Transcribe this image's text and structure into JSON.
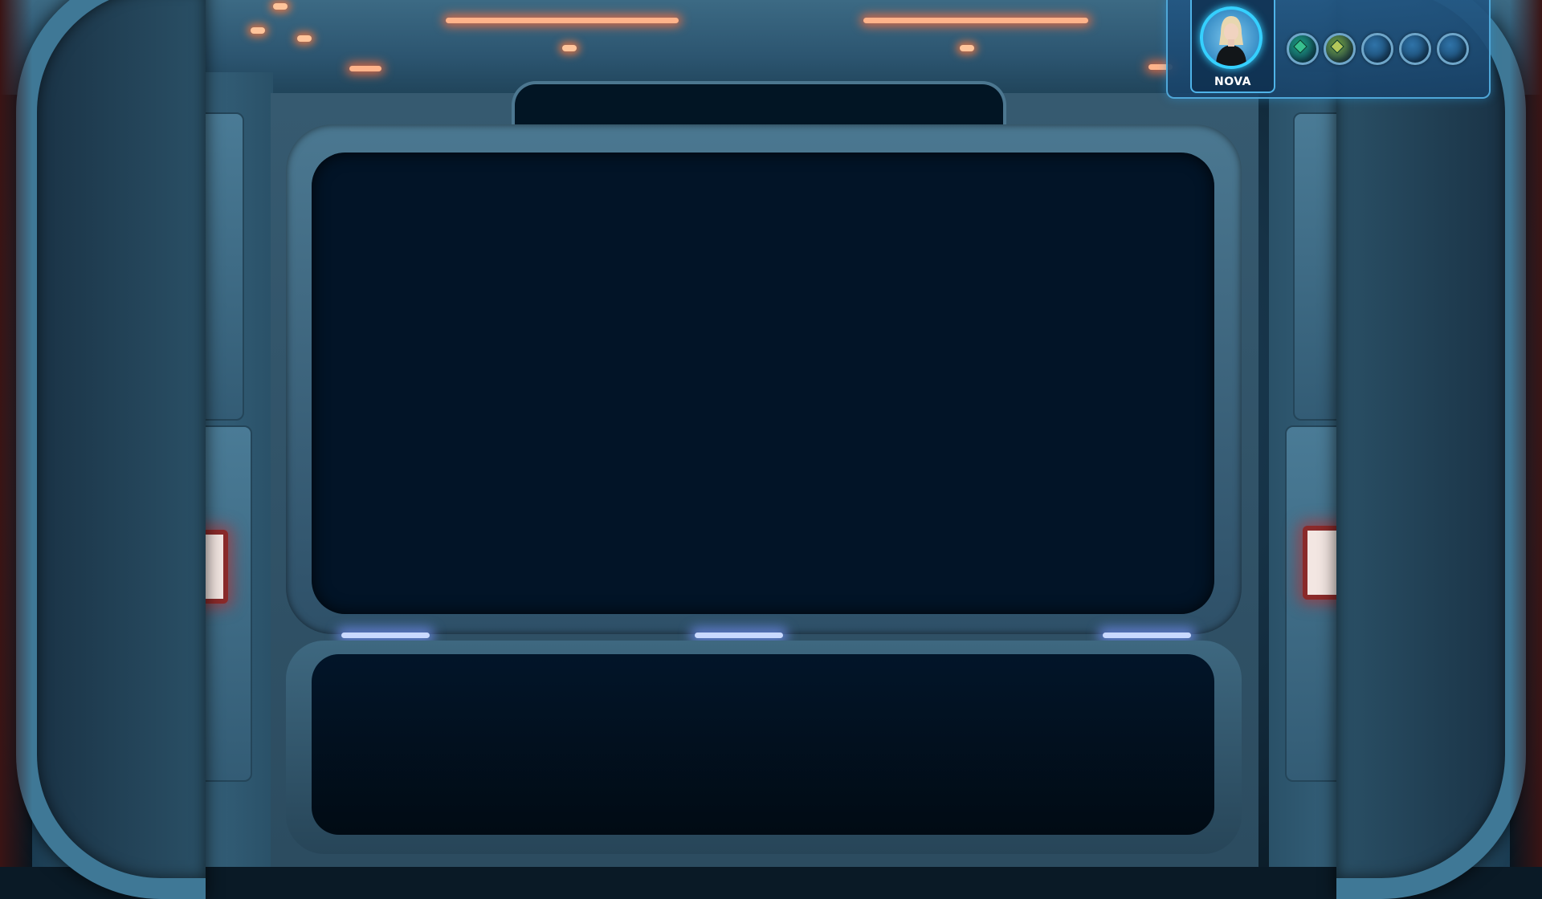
{
  "hud": {
    "character_name": "NOVA",
    "orbs": [
      {
        "name": "green-gem-orb-icon",
        "color": "#1a9a7a",
        "gem": "#38c08f",
        "filled": true
      },
      {
        "name": "yellow-gem-orb-icon",
        "color": "#6f9a3a",
        "gem": "#b4c85a",
        "filled": true
      },
      {
        "name": "empty-orb-1-icon",
        "color": "#2f73a8",
        "filled": false
      },
      {
        "name": "empty-orb-2-icon",
        "color": "#2f73a8",
        "filled": false
      },
      {
        "name": "empty-orb-3-icon",
        "color": "#2f73a8",
        "filled": false
      }
    ]
  },
  "colors": {
    "screen": "#021427",
    "hud_border": "#4fa7d8",
    "avatar_ring": "#35d0ff",
    "ceiling_light": "#ff7a45",
    "accent_glow": "#c9d9ff"
  }
}
